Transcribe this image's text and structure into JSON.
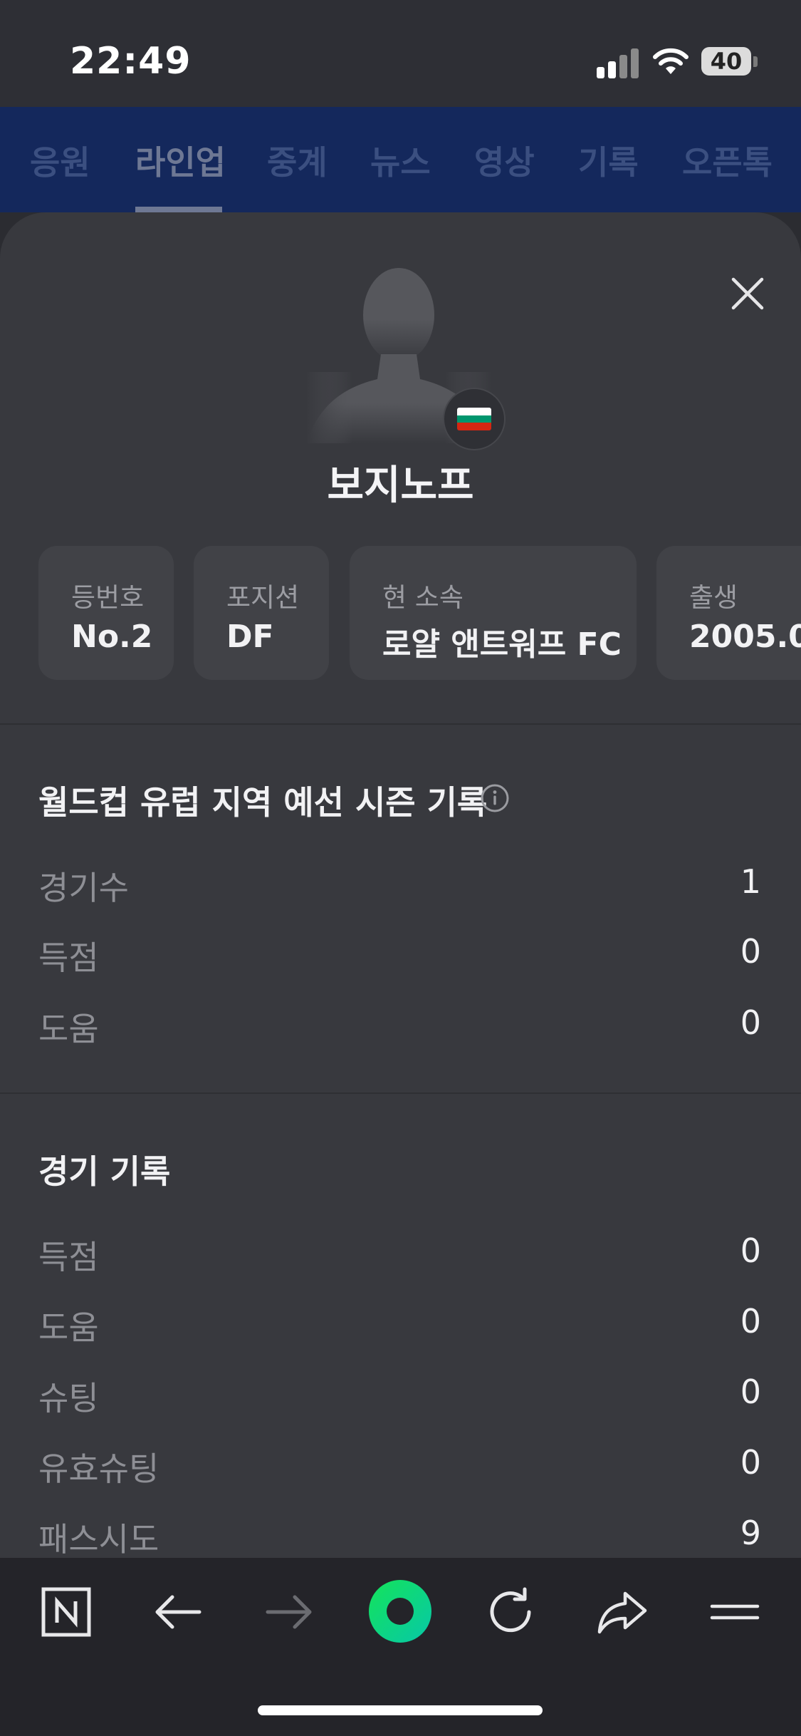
{
  "status_bar": {
    "time": "22:49",
    "battery_level": "40"
  },
  "tabs": [
    {
      "label": "응원",
      "active": false
    },
    {
      "label": "라인업",
      "active": true
    },
    {
      "label": "중계",
      "active": false
    },
    {
      "label": "뉴스",
      "active": false
    },
    {
      "label": "영상",
      "active": false
    },
    {
      "label": "기록",
      "active": false
    },
    {
      "label": "오픈톡",
      "active": false
    }
  ],
  "player": {
    "name": "보지노프",
    "flag_colors": [
      "#ffffff",
      "#00966e",
      "#d62612"
    ],
    "info_cards": [
      {
        "label": "등번호",
        "value": "No.2"
      },
      {
        "label": "포지션",
        "value": "DF"
      },
      {
        "label": "현 소속",
        "value": "로얄 앤트워프 FC"
      },
      {
        "label": "출생",
        "value": "2005.0"
      }
    ]
  },
  "season_stats": {
    "title": "월드컵 유럽 지역 예선 시즌 기록",
    "rows": [
      {
        "label": "경기수",
        "value": "1"
      },
      {
        "label": "득점",
        "value": "0"
      },
      {
        "label": "도움",
        "value": "0"
      }
    ]
  },
  "match_stats": {
    "title": "경기 기록",
    "rows": [
      {
        "label": "득점",
        "value": "0"
      },
      {
        "label": "도움",
        "value": "0"
      },
      {
        "label": "슈팅",
        "value": "0"
      },
      {
        "label": "유효슈팅",
        "value": "0"
      },
      {
        "label": "패스시도",
        "value": "9"
      }
    ]
  },
  "toolbar": {
    "items": [
      "naver-home-icon",
      "back-arrow-icon",
      "forward-arrow-icon",
      "green-dot-icon",
      "reload-icon",
      "share-icon",
      "menu-icon"
    ]
  },
  "colors": {
    "tab_bar": "#14285c",
    "sheet": "#38393e",
    "card": "#414247",
    "accent_green": "#03c75a"
  }
}
